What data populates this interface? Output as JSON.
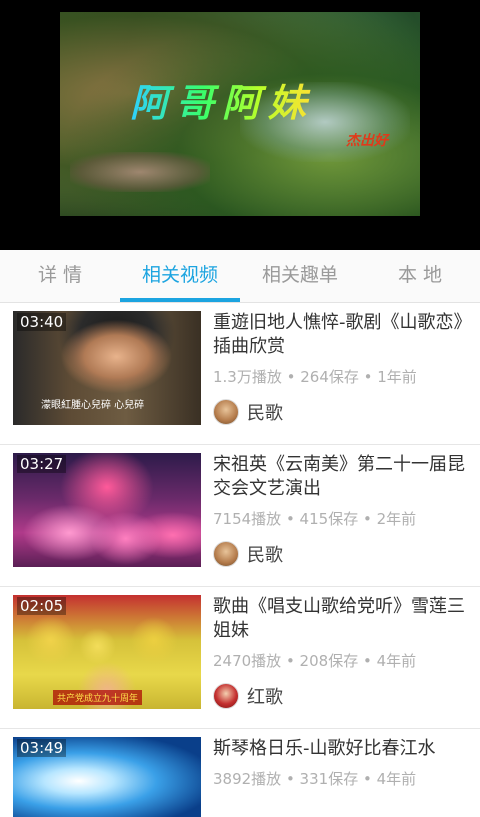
{
  "player": {
    "video_title": "阿哥阿妹",
    "signature": "杰出好"
  },
  "tabs": [
    {
      "label": "详 情",
      "active": false
    },
    {
      "label": "相关视频",
      "active": true
    },
    {
      "label": "相关趣单",
      "active": false
    },
    {
      "label": "本 地",
      "active": false
    }
  ],
  "accent_color": "#1ca4e0",
  "videos": [
    {
      "duration": "03:40",
      "title": "重遊旧地人憔悴-歌剧《山歌恋》插曲欣赏",
      "meta": "1.3万播放 • 264保存 • 1年前",
      "category": "民歌",
      "thumb_caption": "濛眼紅腫心兒碎 心兒碎"
    },
    {
      "duration": "03:27",
      "title": "宋祖英《云南美》第二十一届昆交会文艺演出",
      "meta": "7154播放 • 415保存 • 2年前",
      "category": "民歌"
    },
    {
      "duration": "02:05",
      "title": "歌曲《唱支山歌给党听》雪莲三姐妹",
      "meta": "2470播放 • 208保存 • 4年前",
      "category": "红歌",
      "thumb_caption": "共产党成立九十周年"
    },
    {
      "duration": "03:49",
      "title": "斯琴格日乐-山歌好比春江水",
      "meta": "3892播放 • 331保存 • 4年前"
    }
  ]
}
